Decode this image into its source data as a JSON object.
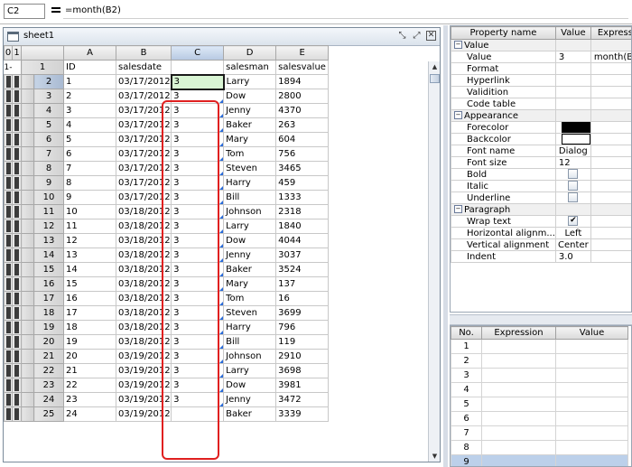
{
  "formula_bar": {
    "cell_ref": "C2",
    "formula": "=month(B2)"
  },
  "sheet": {
    "title": "sheet1",
    "level_buttons": [
      "0",
      "1"
    ],
    "group_marker": "1-",
    "columns": [
      "A",
      "B",
      "C",
      "D",
      "E"
    ],
    "selected_column": "C",
    "header_row": [
      "ID",
      "salesdate",
      "",
      "salesman",
      "salesvalue"
    ],
    "rows": [
      {
        "n": "2",
        "id": "1",
        "date": "03/17/2012",
        "c": "3",
        "man": "Larry",
        "val": "1894"
      },
      {
        "n": "3",
        "id": "2",
        "date": "03/17/2012",
        "c": "3",
        "man": "Dow",
        "val": "2800"
      },
      {
        "n": "4",
        "id": "3",
        "date": "03/17/2012",
        "c": "3",
        "man": "Jenny",
        "val": "4370"
      },
      {
        "n": "5",
        "id": "4",
        "date": "03/17/2012",
        "c": "3",
        "man": "Baker",
        "val": "263"
      },
      {
        "n": "6",
        "id": "5",
        "date": "03/17/2012",
        "c": "3",
        "man": "Mary",
        "val": "604"
      },
      {
        "n": "7",
        "id": "6",
        "date": "03/17/2012",
        "c": "3",
        "man": "Tom",
        "val": "756"
      },
      {
        "n": "8",
        "id": "7",
        "date": "03/17/2012",
        "c": "3",
        "man": "Steven",
        "val": "3465"
      },
      {
        "n": "9",
        "id": "8",
        "date": "03/17/2012",
        "c": "3",
        "man": "Harry",
        "val": "459"
      },
      {
        "n": "10",
        "id": "9",
        "date": "03/17/2012",
        "c": "3",
        "man": "Bill",
        "val": "1333"
      },
      {
        "n": "11",
        "id": "10",
        "date": "03/18/2012",
        "c": "3",
        "man": "Johnson",
        "val": "2318"
      },
      {
        "n": "12",
        "id": "11",
        "date": "03/18/2012",
        "c": "3",
        "man": "Larry",
        "val": "1840"
      },
      {
        "n": "13",
        "id": "12",
        "date": "03/18/2012",
        "c": "3",
        "man": "Dow",
        "val": "4044"
      },
      {
        "n": "14",
        "id": "13",
        "date": "03/18/2012",
        "c": "3",
        "man": "Jenny",
        "val": "3037"
      },
      {
        "n": "15",
        "id": "14",
        "date": "03/18/2012",
        "c": "3",
        "man": "Baker",
        "val": "3524"
      },
      {
        "n": "16",
        "id": "15",
        "date": "03/18/2012",
        "c": "3",
        "man": "Mary",
        "val": "137"
      },
      {
        "n": "17",
        "id": "16",
        "date": "03/18/2012",
        "c": "3",
        "man": "Tom",
        "val": "16"
      },
      {
        "n": "18",
        "id": "17",
        "date": "03/18/2012",
        "c": "3",
        "man": "Steven",
        "val": "3699"
      },
      {
        "n": "19",
        "id": "18",
        "date": "03/18/2012",
        "c": "3",
        "man": "Harry",
        "val": "796"
      },
      {
        "n": "20",
        "id": "19",
        "date": "03/18/2012",
        "c": "3",
        "man": "Bill",
        "val": "119"
      },
      {
        "n": "21",
        "id": "20",
        "date": "03/19/2012",
        "c": "3",
        "man": "Johnson",
        "val": "2910"
      },
      {
        "n": "22",
        "id": "21",
        "date": "03/19/2012",
        "c": "3",
        "man": "Larry",
        "val": "3698"
      },
      {
        "n": "23",
        "id": "22",
        "date": "03/19/2012",
        "c": "3",
        "man": "Dow",
        "val": "3981"
      },
      {
        "n": "24",
        "id": "23",
        "date": "03/19/2012",
        "c": "3",
        "man": "Jenny",
        "val": "3472"
      },
      {
        "n": "25",
        "id": "24",
        "date": "03/19/2012",
        "c": "",
        "man": "Baker",
        "val": "3339"
      }
    ]
  },
  "properties": {
    "headers": [
      "Property name",
      "Value",
      "Expressi"
    ],
    "groups": {
      "value": {
        "name": "Value",
        "items": {
          "value": {
            "label": "Value",
            "value": "3",
            "expr": "month(B..."
          },
          "format": {
            "label": "Format"
          },
          "hyperlink": {
            "label": "Hyperlink"
          },
          "validition": {
            "label": "Validition"
          },
          "code_table": {
            "label": "Code table"
          }
        }
      },
      "appearance": {
        "name": "Appearance",
        "items": {
          "forecolor": {
            "label": "Forecolor",
            "color": "#000000"
          },
          "backcolor": {
            "label": "Backcolor",
            "color": "#ffffff"
          },
          "font_name": {
            "label": "Font name",
            "value": "Dialog"
          },
          "font_size": {
            "label": "Font size",
            "value": "12"
          },
          "bold": {
            "label": "Bold"
          },
          "italic": {
            "label": "Italic"
          },
          "underline": {
            "label": "Underline"
          }
        }
      },
      "paragraph": {
        "name": "Paragraph",
        "items": {
          "wrap_text": {
            "label": "Wrap text",
            "checked": "✔"
          },
          "h_align": {
            "label": "Horizontal alignm...",
            "value": "Left"
          },
          "v_align": {
            "label": "Vertical alignment",
            "value": "Center"
          },
          "indent": {
            "label": "Indent",
            "value": "3.0"
          }
        }
      }
    },
    "collapse_glyph": "−"
  },
  "expressions": {
    "headers": [
      "No.",
      "Expression",
      "Value"
    ],
    "rows": [
      "1",
      "2",
      "3",
      "4",
      "5",
      "6",
      "7",
      "8",
      "9"
    ]
  },
  "icons": {
    "scroll_up": "▲",
    "scroll_down": "▼",
    "restore": "⤡",
    "maximize": "⤢",
    "close": "✕"
  }
}
